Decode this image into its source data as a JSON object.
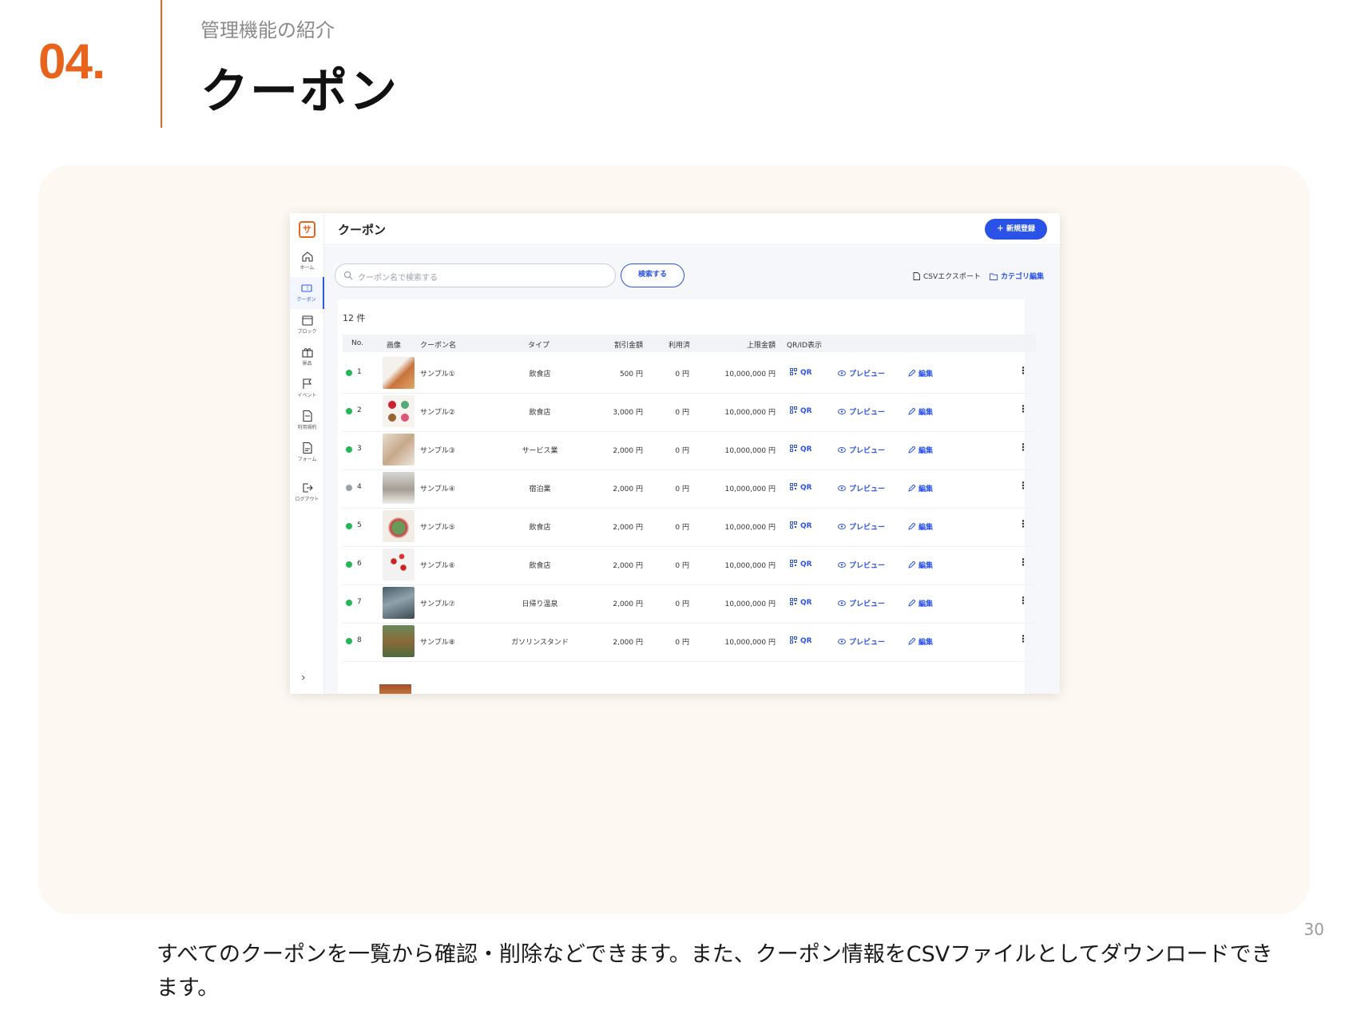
{
  "slide": {
    "section_number": "04.",
    "subtitle": "管理機能の紹介",
    "title": "クーポン",
    "page_number": "30",
    "caption": "すべてのクーポンを一覧から確認・削除などできます。また、クーポン情報をCSVファイルとしてダウンロードできます。",
    "accent_color": "#e8631c"
  },
  "app": {
    "logo_icon": "app-logo-icon",
    "title": "クーポン",
    "new_button": "＋ 新規登録",
    "search_placeholder": "クーポン名で検索する",
    "search_button": "検索する",
    "csv_export": "CSVエクスポート",
    "category_edit": "カテゴリ編集",
    "count_label": "12 件",
    "primary_color": "#2a52e6",
    "sidebar": [
      {
        "label": "ホーム",
        "icon": "home-icon"
      },
      {
        "label": "クーポン",
        "icon": "coupon-icon",
        "active": true
      },
      {
        "label": "ブロック",
        "icon": "calendar-icon"
      },
      {
        "label": "景品",
        "icon": "gift-icon"
      },
      {
        "label": "イベント",
        "icon": "flag-icon"
      },
      {
        "label": "利用規約",
        "icon": "document-icon"
      },
      {
        "label": "フォーム",
        "icon": "form-icon"
      },
      {
        "label": "ログアウト",
        "icon": "logout-icon"
      }
    ],
    "columns": [
      "No.",
      "画像",
      "クーポン名",
      "タイプ",
      "割引金額",
      "利用済",
      "上限金額",
      "QR/ID表示"
    ],
    "rows": [
      {
        "status": "active",
        "no": "1",
        "name": "サンプル①",
        "type": "飲食店",
        "discount": "500 円",
        "used": "0 円",
        "limit": "10,000,000 円",
        "qr": "QR",
        "preview": "プレビュー",
        "edit": "編集"
      },
      {
        "status": "active",
        "no": "2",
        "name": "サンプル②",
        "type": "飲食店",
        "discount": "3,000 円",
        "used": "0 円",
        "limit": "10,000,000 円",
        "qr": "QR",
        "preview": "プレビュー",
        "edit": "編集"
      },
      {
        "status": "active",
        "no": "3",
        "name": "サンプル③",
        "type": "サービス業",
        "discount": "2,000 円",
        "used": "0 円",
        "limit": "10,000,000 円",
        "qr": "QR",
        "preview": "プレビュー",
        "edit": "編集"
      },
      {
        "status": "inactive",
        "no": "4",
        "name": "サンプル④",
        "type": "宿泊業",
        "discount": "2,000 円",
        "used": "0 円",
        "limit": "10,000,000 円",
        "qr": "QR",
        "preview": "プレビュー",
        "edit": "編集"
      },
      {
        "status": "active",
        "no": "5",
        "name": "サンプル⑤",
        "type": "飲食店",
        "discount": "2,000 円",
        "used": "0 円",
        "limit": "10,000,000 円",
        "qr": "QR",
        "preview": "プレビュー",
        "edit": "編集"
      },
      {
        "status": "active",
        "no": "6",
        "name": "サンプル⑥",
        "type": "飲食店",
        "discount": "2,000 円",
        "used": "0 円",
        "limit": "10,000,000 円",
        "qr": "QR",
        "preview": "プレビュー",
        "edit": "編集"
      },
      {
        "status": "active",
        "no": "7",
        "name": "サンプル⑦",
        "type": "日帰り温泉",
        "discount": "2,000 円",
        "used": "0 円",
        "limit": "10,000,000 円",
        "qr": "QR",
        "preview": "プレビュー",
        "edit": "編集"
      },
      {
        "status": "active",
        "no": "8",
        "name": "サンプル⑧",
        "type": "ガソリンスタンド",
        "discount": "2,000 円",
        "used": "0 円",
        "limit": "10,000,000 円",
        "qr": "QR",
        "preview": "プレビュー",
        "edit": "編集"
      }
    ]
  }
}
